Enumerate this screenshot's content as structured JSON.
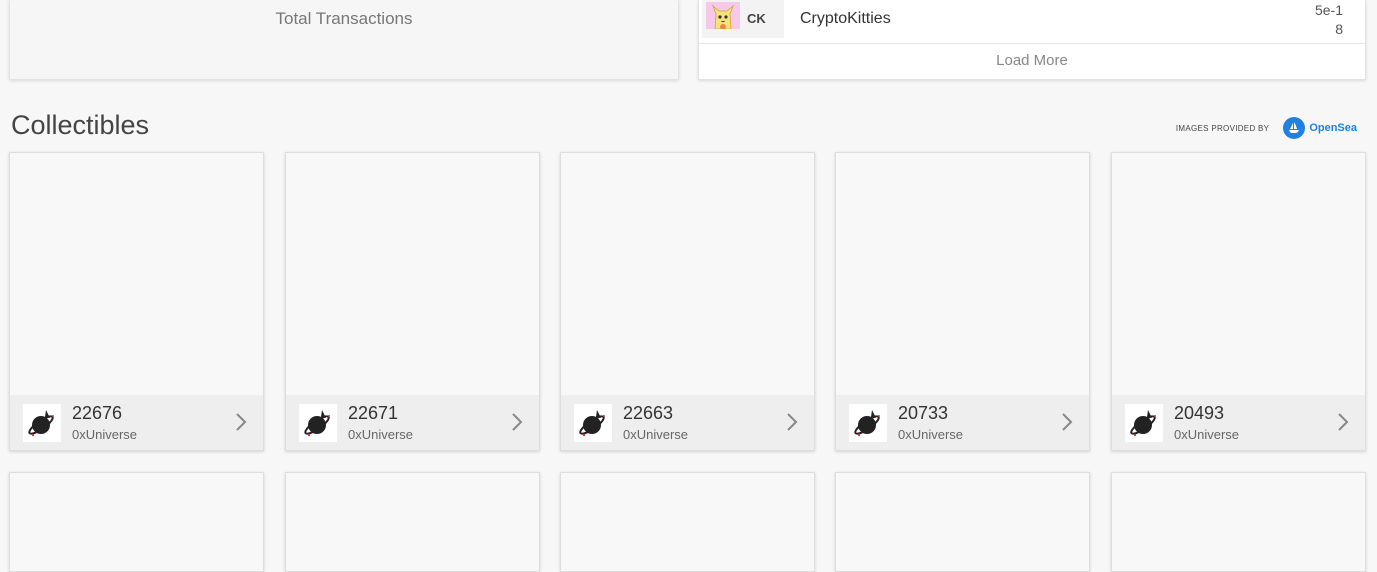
{
  "summary": {
    "total_transactions_label": "Total Transactions"
  },
  "tokens": {
    "row": {
      "symbol": "CK",
      "name": "CryptoKitties",
      "value": "5e-18",
      "avatar_color": "#f7c8e8"
    },
    "load_more_label": "Load More"
  },
  "collectibles": {
    "title": "Collectibles",
    "provided_by_label": "IMAGES PROVIDED BY",
    "provider_name": "OpenSea",
    "provider_color": "#2081e2",
    "items": [
      {
        "id": "22676",
        "collection": "0xUniverse",
        "icon": "planet-ship-icon"
      },
      {
        "id": "22671",
        "collection": "0xUniverse",
        "icon": "planet-ship-icon"
      },
      {
        "id": "22663",
        "collection": "0xUniverse",
        "icon": "planet-ship-icon"
      },
      {
        "id": "20733",
        "collection": "0xUniverse",
        "icon": "planet-ship-icon"
      },
      {
        "id": "20493",
        "collection": "0xUniverse",
        "icon": "planet-ship-icon"
      }
    ]
  }
}
